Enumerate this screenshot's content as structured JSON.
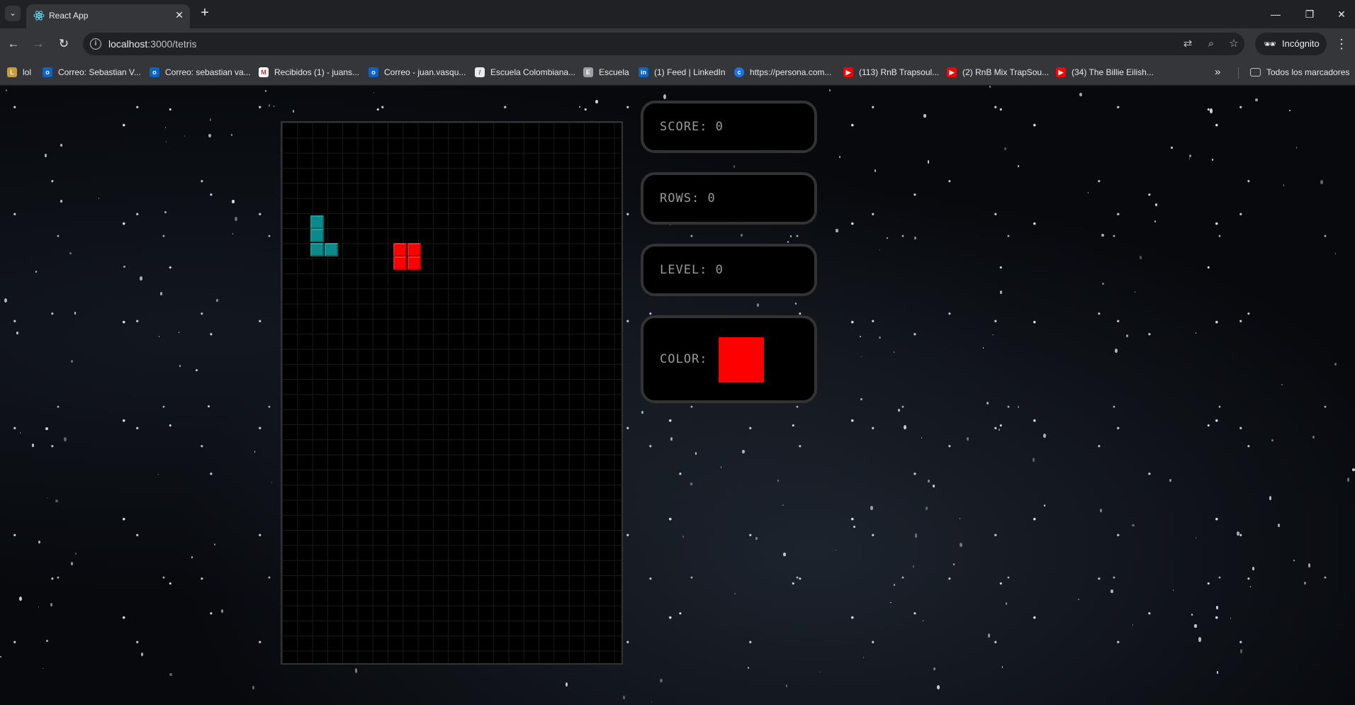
{
  "browser": {
    "tab": {
      "title": "React App"
    },
    "address": {
      "host": "localhost",
      "path": ":3000/tetris"
    },
    "incognito_label": "Incógnito",
    "icons": {
      "tab_search": "chevron-down-icon",
      "new_tab": "plus-icon",
      "back": "arrow-left-icon",
      "forward": "arrow-right-icon",
      "reload": "reload-icon",
      "site_info": "info-icon",
      "translate": "translate-icon",
      "zoom": "zoom-icon",
      "bookmark": "star-icon",
      "menu": "more-vert-icon"
    }
  },
  "bookmarks": {
    "items": [
      {
        "label": "lol",
        "icon": "lol-favicon",
        "color": "#c89b3c"
      },
      {
        "label": "Correo: Sebastian V...",
        "icon": "outlook-favicon",
        "color": "#0a64c8"
      },
      {
        "label": "Correo: sebastian va...",
        "icon": "outlook-favicon",
        "color": "#0a64c8"
      },
      {
        "label": "Recibidos (1) - juans...",
        "icon": "gmail-favicon",
        "color": "#d93025"
      },
      {
        "label": "Correo - juan.vasqu...",
        "icon": "outlook-favicon",
        "color": "#0a64c8"
      },
      {
        "label": "Escuela Colombiana...",
        "icon": "page-favicon",
        "color": "#e8eaed"
      },
      {
        "label": "Escuela",
        "icon": "school-favicon",
        "color": "#9aa0a6"
      },
      {
        "label": "(1) Feed | LinkedIn",
        "icon": "linkedin-favicon",
        "color": "#0a66c2"
      },
      {
        "label": "https://persona.com...",
        "icon": "persona-favicon",
        "color": "#1a73e8"
      },
      {
        "label": "(113) RnB Trapsoul...",
        "icon": "youtube-favicon",
        "color": "#ff0000"
      },
      {
        "label": "(2) RnB Mix TrapSou...",
        "icon": "youtube-favicon",
        "color": "#ff0000"
      },
      {
        "label": "(34) The Billie Eilish...",
        "icon": "youtube-favicon",
        "color": "#ff0000"
      }
    ],
    "all_bookmarks_label": "Todos los marcadores"
  },
  "game": {
    "stage": {
      "columns": 12,
      "rows": 20
    },
    "pieces": [
      {
        "name": "L-piece",
        "color": "#0a8a8a",
        "cells": [
          [
            2,
            5
          ],
          [
            2,
            6
          ],
          [
            2,
            7
          ],
          [
            3,
            7
          ]
        ]
      },
      {
        "name": "O-piece",
        "color": "#ff0000",
        "cells": [
          [
            8,
            7
          ],
          [
            9,
            7
          ],
          [
            8,
            8
          ],
          [
            9,
            8
          ]
        ]
      }
    ],
    "display": {
      "score": {
        "label": "SCORE:",
        "value": "0"
      },
      "rows": {
        "label": "ROWS:",
        "value": "0"
      },
      "level": {
        "label": "LEVEL:",
        "value": "0"
      },
      "color": {
        "label": "COLOR:",
        "value": "#ff0000"
      }
    }
  }
}
